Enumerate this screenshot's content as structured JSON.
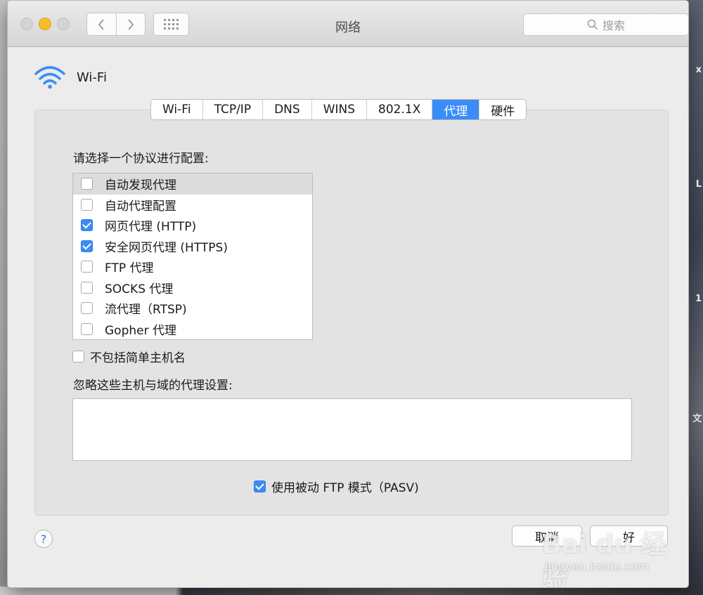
{
  "window": {
    "title": "网络",
    "search_placeholder": "搜索"
  },
  "header": {
    "interface_name": "Wi-Fi"
  },
  "tabs": [
    {
      "label": "Wi-Fi"
    },
    {
      "label": "TCP/IP"
    },
    {
      "label": "DNS"
    },
    {
      "label": "WINS"
    },
    {
      "label": "802.1X"
    },
    {
      "label": "代理",
      "active": true
    },
    {
      "label": "硬件"
    }
  ],
  "proxy": {
    "prompt": "请选择一个协议进行配置:",
    "protocols": [
      {
        "label": "自动发现代理",
        "checked": false
      },
      {
        "label": "自动代理配置",
        "checked": false
      },
      {
        "label": "网页代理 (HTTP)",
        "checked": true
      },
      {
        "label": "安全网页代理 (HTTPS)",
        "checked": true
      },
      {
        "label": "FTP 代理",
        "checked": false
      },
      {
        "label": "SOCKS 代理",
        "checked": false
      },
      {
        "label": "流代理（RTSP)",
        "checked": false
      },
      {
        "label": "Gopher 代理",
        "checked": false
      }
    ],
    "exclude_simple_hostnames": "不包括简单主机名",
    "ignore_label": "忽略这些主机与域的代理设置:",
    "ignore_value": "",
    "pasv_label": "使用被动 FTP 模式（PASV)"
  },
  "buttons": {
    "help": "?",
    "cancel": "取消",
    "ok": "好"
  },
  "watermark": {
    "logo": "Bai du 经验",
    "url": "jingyan.baidu.com"
  },
  "background": {
    "right_edge_glyphs": [
      "x",
      "L",
      "1",
      "文"
    ]
  },
  "colors": {
    "accent": "#3b8cf7",
    "minimize": "#f6bd2d"
  }
}
